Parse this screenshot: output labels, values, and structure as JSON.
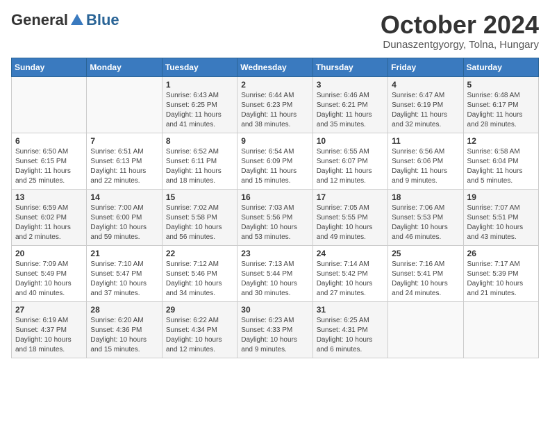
{
  "header": {
    "logo": {
      "general": "General",
      "blue": "Blue"
    },
    "title": "October 2024",
    "subtitle": "Dunaszentgyorgy, Tolna, Hungary"
  },
  "calendar": {
    "weekdays": [
      "Sunday",
      "Monday",
      "Tuesday",
      "Wednesday",
      "Thursday",
      "Friday",
      "Saturday"
    ],
    "weeks": [
      [
        {
          "day": "",
          "sunrise": "",
          "sunset": "",
          "daylight": ""
        },
        {
          "day": "",
          "sunrise": "",
          "sunset": "",
          "daylight": ""
        },
        {
          "day": "1",
          "sunrise": "Sunrise: 6:43 AM",
          "sunset": "Sunset: 6:25 PM",
          "daylight": "Daylight: 11 hours and 41 minutes."
        },
        {
          "day": "2",
          "sunrise": "Sunrise: 6:44 AM",
          "sunset": "Sunset: 6:23 PM",
          "daylight": "Daylight: 11 hours and 38 minutes."
        },
        {
          "day": "3",
          "sunrise": "Sunrise: 6:46 AM",
          "sunset": "Sunset: 6:21 PM",
          "daylight": "Daylight: 11 hours and 35 minutes."
        },
        {
          "day": "4",
          "sunrise": "Sunrise: 6:47 AM",
          "sunset": "Sunset: 6:19 PM",
          "daylight": "Daylight: 11 hours and 32 minutes."
        },
        {
          "day": "5",
          "sunrise": "Sunrise: 6:48 AM",
          "sunset": "Sunset: 6:17 PM",
          "daylight": "Daylight: 11 hours and 28 minutes."
        }
      ],
      [
        {
          "day": "6",
          "sunrise": "Sunrise: 6:50 AM",
          "sunset": "Sunset: 6:15 PM",
          "daylight": "Daylight: 11 hours and 25 minutes."
        },
        {
          "day": "7",
          "sunrise": "Sunrise: 6:51 AM",
          "sunset": "Sunset: 6:13 PM",
          "daylight": "Daylight: 11 hours and 22 minutes."
        },
        {
          "day": "8",
          "sunrise": "Sunrise: 6:52 AM",
          "sunset": "Sunset: 6:11 PM",
          "daylight": "Daylight: 11 hours and 18 minutes."
        },
        {
          "day": "9",
          "sunrise": "Sunrise: 6:54 AM",
          "sunset": "Sunset: 6:09 PM",
          "daylight": "Daylight: 11 hours and 15 minutes."
        },
        {
          "day": "10",
          "sunrise": "Sunrise: 6:55 AM",
          "sunset": "Sunset: 6:07 PM",
          "daylight": "Daylight: 11 hours and 12 minutes."
        },
        {
          "day": "11",
          "sunrise": "Sunrise: 6:56 AM",
          "sunset": "Sunset: 6:06 PM",
          "daylight": "Daylight: 11 hours and 9 minutes."
        },
        {
          "day": "12",
          "sunrise": "Sunrise: 6:58 AM",
          "sunset": "Sunset: 6:04 PM",
          "daylight": "Daylight: 11 hours and 5 minutes."
        }
      ],
      [
        {
          "day": "13",
          "sunrise": "Sunrise: 6:59 AM",
          "sunset": "Sunset: 6:02 PM",
          "daylight": "Daylight: 11 hours and 2 minutes."
        },
        {
          "day": "14",
          "sunrise": "Sunrise: 7:00 AM",
          "sunset": "Sunset: 6:00 PM",
          "daylight": "Daylight: 10 hours and 59 minutes."
        },
        {
          "day": "15",
          "sunrise": "Sunrise: 7:02 AM",
          "sunset": "Sunset: 5:58 PM",
          "daylight": "Daylight: 10 hours and 56 minutes."
        },
        {
          "day": "16",
          "sunrise": "Sunrise: 7:03 AM",
          "sunset": "Sunset: 5:56 PM",
          "daylight": "Daylight: 10 hours and 53 minutes."
        },
        {
          "day": "17",
          "sunrise": "Sunrise: 7:05 AM",
          "sunset": "Sunset: 5:55 PM",
          "daylight": "Daylight: 10 hours and 49 minutes."
        },
        {
          "day": "18",
          "sunrise": "Sunrise: 7:06 AM",
          "sunset": "Sunset: 5:53 PM",
          "daylight": "Daylight: 10 hours and 46 minutes."
        },
        {
          "day": "19",
          "sunrise": "Sunrise: 7:07 AM",
          "sunset": "Sunset: 5:51 PM",
          "daylight": "Daylight: 10 hours and 43 minutes."
        }
      ],
      [
        {
          "day": "20",
          "sunrise": "Sunrise: 7:09 AM",
          "sunset": "Sunset: 5:49 PM",
          "daylight": "Daylight: 10 hours and 40 minutes."
        },
        {
          "day": "21",
          "sunrise": "Sunrise: 7:10 AM",
          "sunset": "Sunset: 5:47 PM",
          "daylight": "Daylight: 10 hours and 37 minutes."
        },
        {
          "day": "22",
          "sunrise": "Sunrise: 7:12 AM",
          "sunset": "Sunset: 5:46 PM",
          "daylight": "Daylight: 10 hours and 34 minutes."
        },
        {
          "day": "23",
          "sunrise": "Sunrise: 7:13 AM",
          "sunset": "Sunset: 5:44 PM",
          "daylight": "Daylight: 10 hours and 30 minutes."
        },
        {
          "day": "24",
          "sunrise": "Sunrise: 7:14 AM",
          "sunset": "Sunset: 5:42 PM",
          "daylight": "Daylight: 10 hours and 27 minutes."
        },
        {
          "day": "25",
          "sunrise": "Sunrise: 7:16 AM",
          "sunset": "Sunset: 5:41 PM",
          "daylight": "Daylight: 10 hours and 24 minutes."
        },
        {
          "day": "26",
          "sunrise": "Sunrise: 7:17 AM",
          "sunset": "Sunset: 5:39 PM",
          "daylight": "Daylight: 10 hours and 21 minutes."
        }
      ],
      [
        {
          "day": "27",
          "sunrise": "Sunrise: 6:19 AM",
          "sunset": "Sunset: 4:37 PM",
          "daylight": "Daylight: 10 hours and 18 minutes."
        },
        {
          "day": "28",
          "sunrise": "Sunrise: 6:20 AM",
          "sunset": "Sunset: 4:36 PM",
          "daylight": "Daylight: 10 hours and 15 minutes."
        },
        {
          "day": "29",
          "sunrise": "Sunrise: 6:22 AM",
          "sunset": "Sunset: 4:34 PM",
          "daylight": "Daylight: 10 hours and 12 minutes."
        },
        {
          "day": "30",
          "sunrise": "Sunrise: 6:23 AM",
          "sunset": "Sunset: 4:33 PM",
          "daylight": "Daylight: 10 hours and 9 minutes."
        },
        {
          "day": "31",
          "sunrise": "Sunrise: 6:25 AM",
          "sunset": "Sunset: 4:31 PM",
          "daylight": "Daylight: 10 hours and 6 minutes."
        },
        {
          "day": "",
          "sunrise": "",
          "sunset": "",
          "daylight": ""
        },
        {
          "day": "",
          "sunrise": "",
          "sunset": "",
          "daylight": ""
        }
      ]
    ]
  }
}
